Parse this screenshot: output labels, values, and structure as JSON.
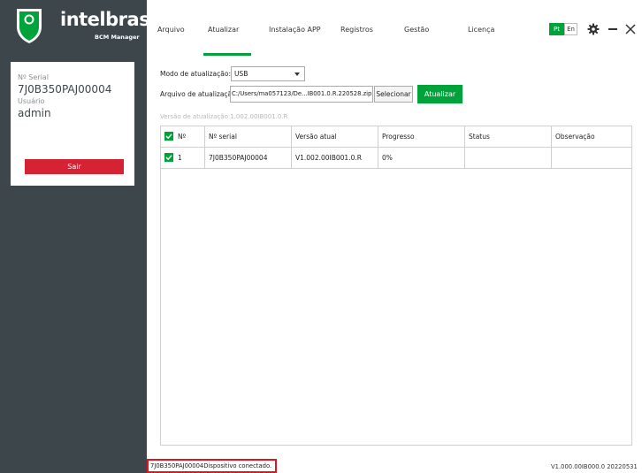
{
  "brand": {
    "name": "intelbras",
    "subtitle": "BCM Manager"
  },
  "device": {
    "serial_label": "Nº Serial",
    "serial_value": "7J0B350PAJ00004",
    "user_label": "Usuário",
    "user_value": "admin",
    "logout_label": "Sair"
  },
  "nav": {
    "items": [
      "Arquivo",
      "Atualizar",
      "Instalação APP",
      "Registros",
      "Gestão",
      "Licença"
    ],
    "active": "Atualizar",
    "lang_pt": "Pt",
    "lang_en": "En"
  },
  "update": {
    "mode_label": "Modo de atualização:",
    "mode_value": "USB",
    "file_label": "Arquivo de atualização:",
    "file_value": "C:/Users/ma057123/De...IB001.0.R.220528.zip",
    "select_label": "Selecionar",
    "update_label": "Atualizar",
    "version_hint": "Versão de atualização:1.002.00IB001.0.R"
  },
  "table": {
    "headers": [
      "Nº",
      "Nº serial",
      "Versão atual",
      "Progresso",
      "Status",
      "Observação"
    ],
    "rows": [
      {
        "no": "1",
        "serial": "7J0B350PAJ00004",
        "version": "V1.002.00IB001.0.R",
        "progress": "0%",
        "status": "",
        "observation": ""
      }
    ]
  },
  "statusbar": {
    "message": "7J0B350PAJ00004Dispositivo conectado.",
    "version": "V1.000.00IB000.0 20220531"
  },
  "colors": {
    "sidebar": "#3d474b",
    "accent": "#00a33a",
    "danger": "#d62333"
  },
  "icons": [
    "shield-logo-icon",
    "gear-icon",
    "minimize-icon",
    "close-icon",
    "checkbox-checked-icon",
    "dropdown-caret-icon"
  ]
}
